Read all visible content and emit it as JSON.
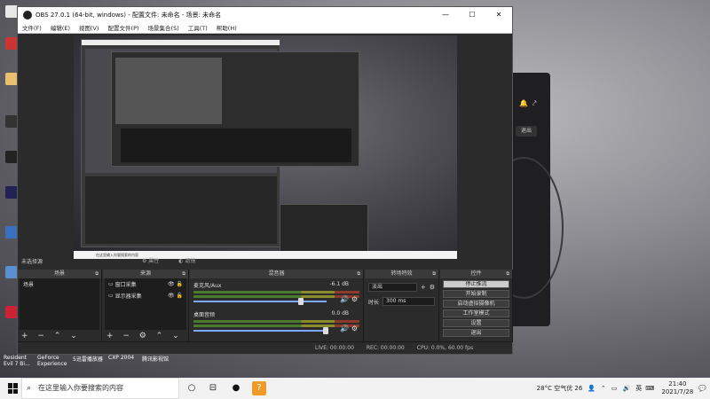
{
  "obs": {
    "title": "OBS 27.0.1 (64-bit, windows) - 配置文件: 未命名 - 场景: 未命名",
    "window_controls": [
      "—",
      "☐",
      "✕"
    ],
    "menu": [
      "文件(F)",
      "编辑(E)",
      "视图(V)",
      "配置文件(P)",
      "场景集合(S)",
      "工具(T)",
      "帮助(H)"
    ],
    "status_label": "未选择源",
    "preview_controls": [
      "属性",
      "滤镜"
    ],
    "preview_taskbar_search": "在这里输入你要搜索的内容",
    "docks": {
      "scenes": {
        "title": "场景",
        "items": [
          "场景"
        ]
      },
      "sources": {
        "title": "来源",
        "items": [
          "窗口采集",
          "显示器采集"
        ]
      },
      "mixer": {
        "title": "混音器",
        "channels": [
          {
            "name": "麦克风/Aux",
            "db": "-6.1 dB"
          },
          {
            "name": "桌面音频",
            "db": "0.0 dB"
          }
        ]
      },
      "transitions": {
        "title": "转场特效",
        "type": "淡出",
        "duration_label": "时长",
        "duration": "300 ms"
      },
      "controls": {
        "title": "控件",
        "buttons": [
          "停止推流",
          "开始录制",
          "启动虚拟摄像机",
          "工作室模式",
          "设置",
          "退出"
        ]
      }
    },
    "statusbar": {
      "live": "LIVE: 00:00:00",
      "rec": "REC: 00:00:00",
      "cpu": "CPU: 0.0%, 60.00 fps"
    }
  },
  "desktop": {
    "bottom_labels": [
      "Resident Evil 7 Bi...",
      "GeForce Experience",
      "5迅雷播放器",
      "CXP 2004",
      "腾讯影视馆"
    ],
    "bg_app_button": "退出"
  },
  "taskbar": {
    "search_placeholder": "在这里输入你要搜索的内容",
    "weather": "28°C 空气优 26",
    "ime": "英",
    "time": "21:40",
    "date": "2021/7/28"
  }
}
